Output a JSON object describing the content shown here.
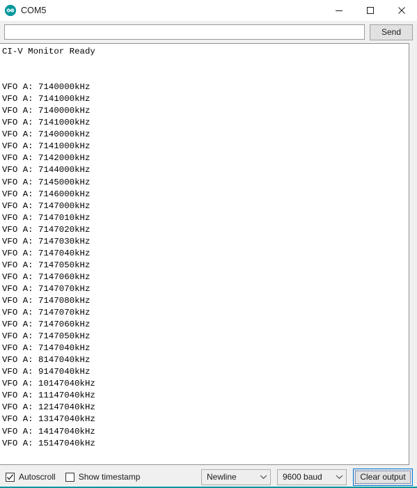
{
  "window": {
    "title": "COM5",
    "logo_icon": "arduino-logo-icon",
    "controls": [
      {
        "name": "minimize-button",
        "icon": "minimize-icon"
      },
      {
        "name": "maximize-button",
        "icon": "maximize-icon"
      },
      {
        "name": "close-button",
        "icon": "close-icon"
      }
    ]
  },
  "send_row": {
    "input_value": "",
    "input_placeholder": "",
    "send_label": "Send"
  },
  "console": {
    "lines": [
      "CI-V Monitor Ready",
      "",
      "",
      "VFO A: 7140000kHz",
      "VFO A: 7141000kHz",
      "VFO A: 7140000kHz",
      "VFO A: 7141000kHz",
      "VFO A: 7140000kHz",
      "VFO A: 7141000kHz",
      "VFO A: 7142000kHz",
      "VFO A: 7144000kHz",
      "VFO A: 7145000kHz",
      "VFO A: 7146000kHz",
      "VFO A: 7147000kHz",
      "VFO A: 7147010kHz",
      "VFO A: 7147020kHz",
      "VFO A: 7147030kHz",
      "VFO A: 7147040kHz",
      "VFO A: 7147050kHz",
      "VFO A: 7147060kHz",
      "VFO A: 7147070kHz",
      "VFO A: 7147080kHz",
      "VFO A: 7147070kHz",
      "VFO A: 7147060kHz",
      "VFO A: 7147050kHz",
      "VFO A: 7147040kHz",
      "VFO A: 8147040kHz",
      "VFO A: 9147040kHz",
      "VFO A: 10147040kHz",
      "VFO A: 11147040kHz",
      "VFO A: 12147040kHz",
      "VFO A: 13147040kHz",
      "VFO A: 14147040kHz",
      "VFO A: 15147040kHz"
    ]
  },
  "status_bar": {
    "autoscroll": {
      "label": "Autoscroll",
      "checked": true
    },
    "show_timestamp": {
      "label": "Show timestamp",
      "checked": false
    },
    "line_ending": {
      "selected": "Newline"
    },
    "baud_rate": {
      "selected": "9600 baud"
    },
    "clear_output_label": "Clear output"
  },
  "colors": {
    "accent_teal": "#00979C",
    "focus_blue": "#0078D7"
  }
}
